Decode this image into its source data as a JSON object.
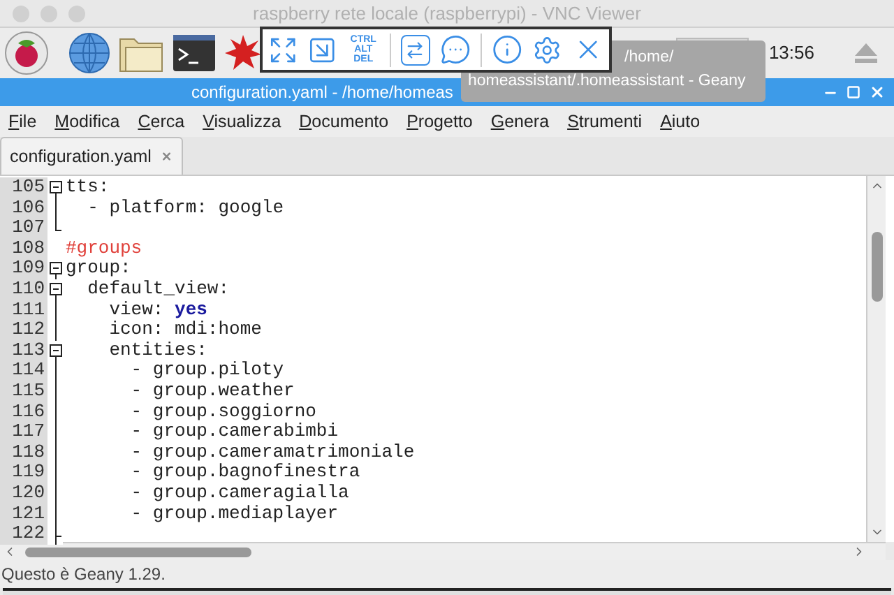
{
  "window": {
    "title": "raspberry rete locale (raspberrypi) - VNC Viewer"
  },
  "panel": {
    "clock": "13:56"
  },
  "vnc_toolbar": {
    "ctrl_alt_del": [
      "CTRL",
      "ALT",
      "DEL"
    ]
  },
  "tooltip": {
    "lines": [
      "/home/",
      "homeassistant/.homeassistant - Geany"
    ]
  },
  "editor_window": {
    "title": "configuration.yaml - /home/homeas"
  },
  "menu": [
    "File",
    "Modifica",
    "Cerca",
    "Visualizza",
    "Documento",
    "Progetto",
    "Genera",
    "Strumenti",
    "Aiuto"
  ],
  "tabs": [
    {
      "label": "configuration.yaml",
      "selected": true
    }
  ],
  "lines": [
    {
      "number": "105",
      "kind": "open",
      "segments": [
        {
          "kind": "plain",
          "text": "tts:"
        }
      ]
    },
    {
      "number": "106",
      "kind": "line",
      "segments": [
        {
          "kind": "plain",
          "text": "  - platform: google"
        }
      ]
    },
    {
      "number": "107",
      "kind": "end"
    },
    {
      "number": "108",
      "kind": "none",
      "segments": [
        {
          "kind": "comment",
          "text": "#groups"
        }
      ]
    },
    {
      "number": "109",
      "kind": "open",
      "segments": [
        {
          "kind": "plain",
          "text": "group:"
        }
      ]
    },
    {
      "number": "110",
      "kind": "open",
      "segments": [
        {
          "kind": "plain",
          "text": "  default_view:"
        }
      ]
    },
    {
      "number": "111",
      "kind": "line",
      "segments": [
        {
          "kind": "plain",
          "text": "    view: "
        },
        {
          "kind": "keyword",
          "text": "yes"
        }
      ]
    },
    {
      "number": "112",
      "kind": "line",
      "segments": [
        {
          "kind": "plain",
          "text": "    icon: mdi:home"
        }
      ]
    },
    {
      "number": "113",
      "kind": "open",
      "segments": [
        {
          "kind": "plain",
          "text": "    entities:"
        }
      ]
    },
    {
      "number": "114",
      "kind": "line",
      "segments": [
        {
          "kind": "plain",
          "text": "      - group.piloty"
        }
      ]
    },
    {
      "number": "115",
      "kind": "line",
      "segments": [
        {
          "kind": "plain",
          "text": "      - group.weather"
        }
      ]
    },
    {
      "number": "116",
      "kind": "line",
      "segments": [
        {
          "kind": "plain",
          "text": "      - group.soggiorno"
        }
      ]
    },
    {
      "number": "117",
      "kind": "line",
      "segments": [
        {
          "kind": "plain",
          "text": "      - group.camerabimbi"
        }
      ]
    },
    {
      "number": "118",
      "kind": "line",
      "segments": [
        {
          "kind": "plain",
          "text": "      - group.cameramatrimoniale"
        }
      ]
    },
    {
      "number": "119",
      "kind": "line",
      "segments": [
        {
          "kind": "plain",
          "text": "      - group.bagnofinestra"
        }
      ]
    },
    {
      "number": "120",
      "kind": "line",
      "segments": [
        {
          "kind": "plain",
          "text": "      - group.cameragialla"
        }
      ]
    },
    {
      "number": "121",
      "kind": "line",
      "segments": [
        {
          "kind": "plain",
          "text": "      - group.mediaplayer"
        }
      ]
    },
    {
      "number": "122",
      "kind": "branch"
    }
  ],
  "status_bar": "Questo è Geany 1.29."
}
